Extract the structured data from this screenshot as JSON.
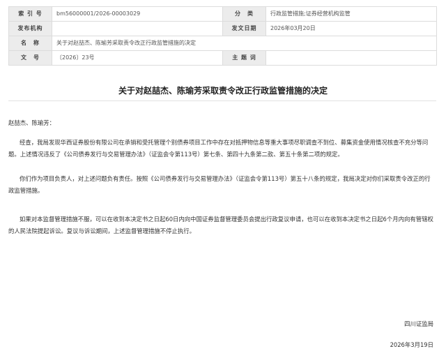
{
  "meta": {
    "index_label": "索 引 号",
    "index_value": "bm56000001/2026-00003029",
    "category_label": "分　类",
    "category_value": "行政监管措施;证券经营机构监管",
    "publisher_label": "发布机构",
    "publisher_value": "",
    "date_label": "发文日期",
    "date_value": "2026年03月20日",
    "name_label": "名　称",
    "name_value": "关于对赵喆杰、陈瑜芳采取责令改正行政监管措施的决定",
    "docno_label": "文　号",
    "docno_value": "〔2026〕23号",
    "subject_label": "主 题 词",
    "subject_value": ""
  },
  "document": {
    "title": "关于对赵喆杰、陈瑜芳采取责令改正行政监管措施的决定",
    "salutation": "赵喆杰、陈瑜芳：",
    "paragraphs": [
      "经查，我局发现华西证券股份有限公司在承销和受托管理个别债券项目工作中存在对抵押物信息等重大事项尽职调查不到位、募集资金使用情况核查不充分等问题。上述情况违反了《公司债券发行与交易管理办法》（证监会令第113号）第七条、第四十九条第二款、第五十条第二项的规定。",
      "你们作为项目负责人，对上述问题负有责任。按照《公司债券发行与交易管理办法》（证监会令第113号）第五十八条的规定，我局决定对你们采取责令改正的行政监管措施。",
      "如果对本监督管理措施不服，可以在收到本决定书之日起60日内向中国证券监督管理委员会提出行政复议申请，也可以在收到本决定书之日起6个月内向有管辖权的人民法院提起诉讼。复议与诉讼期间，上述监督管理措施不停止执行。"
    ],
    "signature": "四川证监局",
    "sign_date": "2026年3月19日"
  }
}
